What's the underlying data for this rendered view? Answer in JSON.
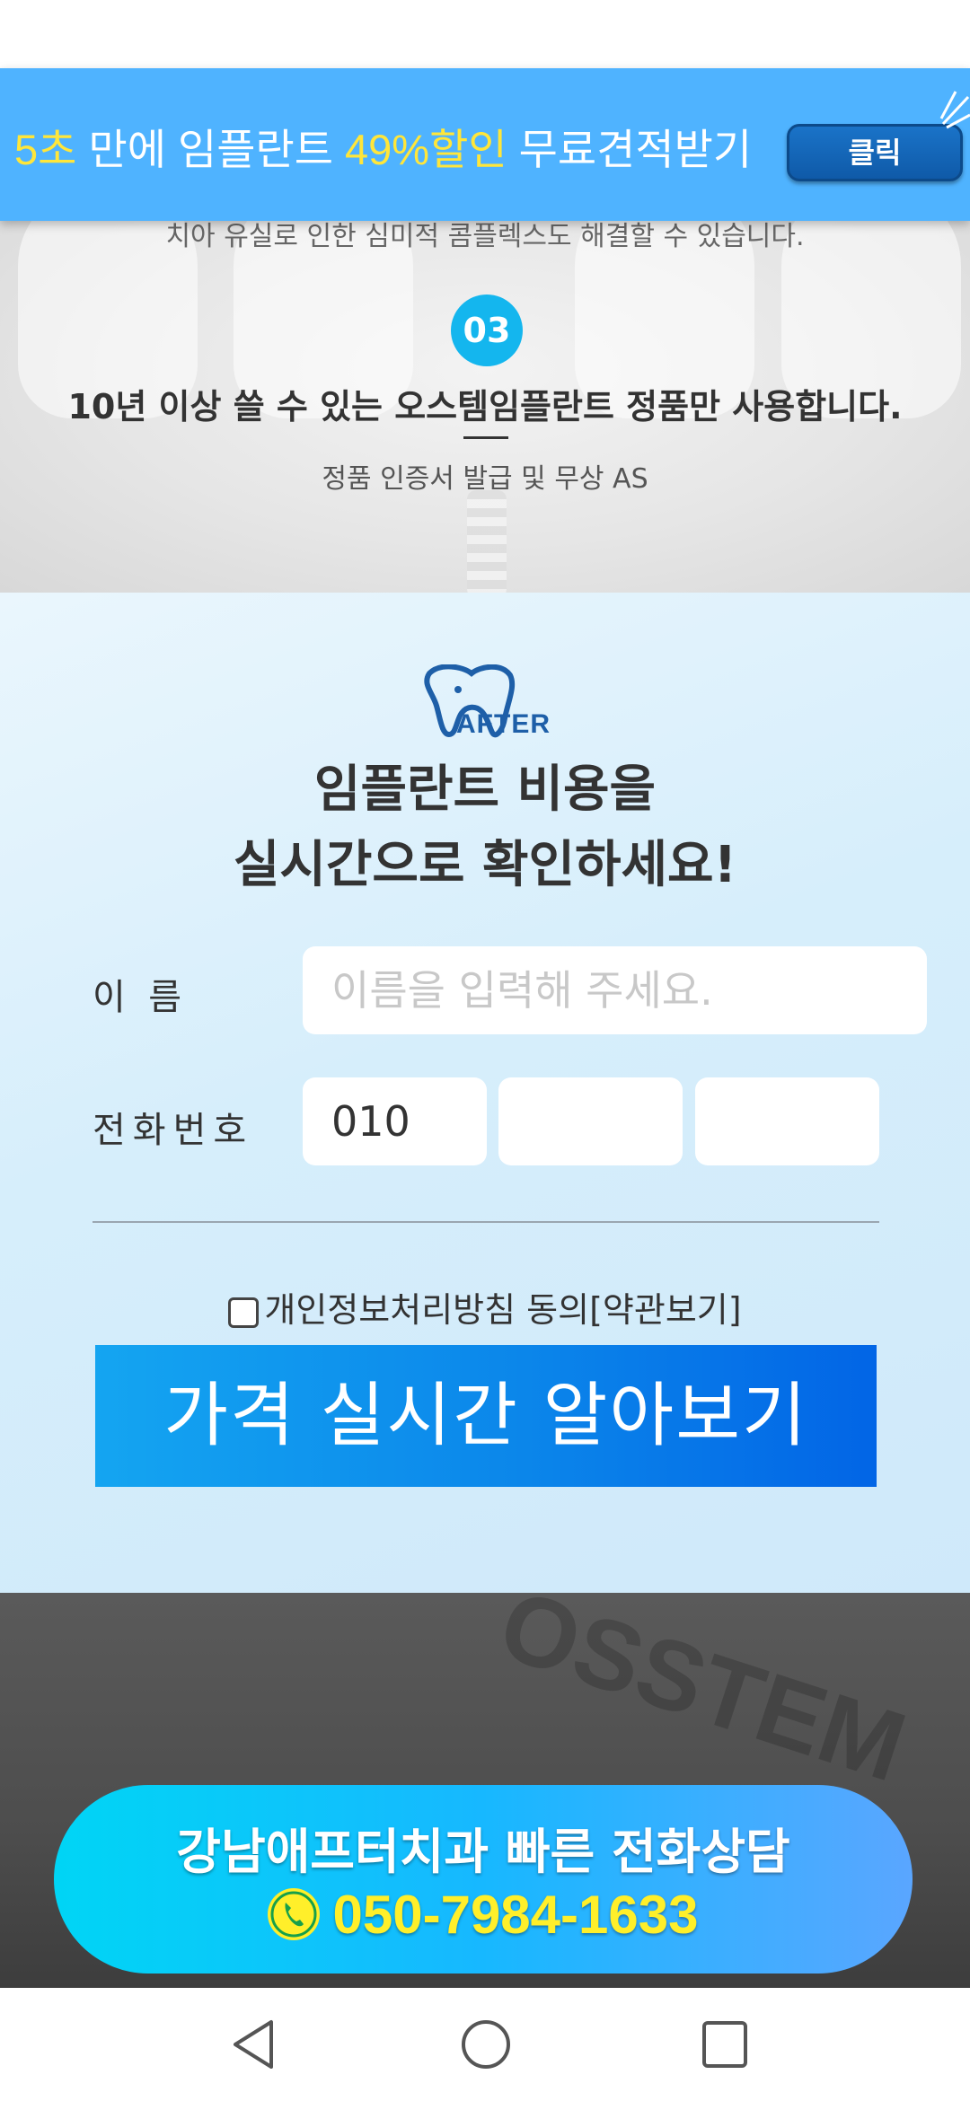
{
  "promo": {
    "seconds": "5초",
    "middle": " 만에 임플란트 ",
    "discount": "49%할인",
    "end": " 무료견적받기",
    "button_label": "클릭"
  },
  "features": {
    "partial_text": "치아 유실로 인한 심미적 콤플렉스도 해결할 수 있습니다.",
    "number": "03",
    "title": "10년 이상 쓸 수 있는 오스템임플란트 정품만 사용합니다.",
    "subtitle": "정품 인증서 발급 및 무상 AS"
  },
  "form": {
    "logo_text": "AFTER",
    "title_line1": "임플란트 비용을",
    "title_line2": "실시간으로 확인하세요!",
    "name_label": "이  름",
    "name_placeholder": "이름을 입력해 주세요.",
    "phone_label": "전화번호",
    "phone_prefix": "010",
    "agree_text": "개인정보처리방침 동의[약관보기]",
    "submit_label": "가격 실시간 알아보기"
  },
  "call": {
    "line1": "강남애프터치과 빠른 전화상담",
    "phone": "050-7984-1633"
  },
  "bottom": {
    "bg_brand": "OSSTEM"
  },
  "colors": {
    "promo_bg": "#4fb3ff",
    "highlight": "#ffe63a",
    "badge": "#14b6ee",
    "submit": "#0b86ea"
  }
}
